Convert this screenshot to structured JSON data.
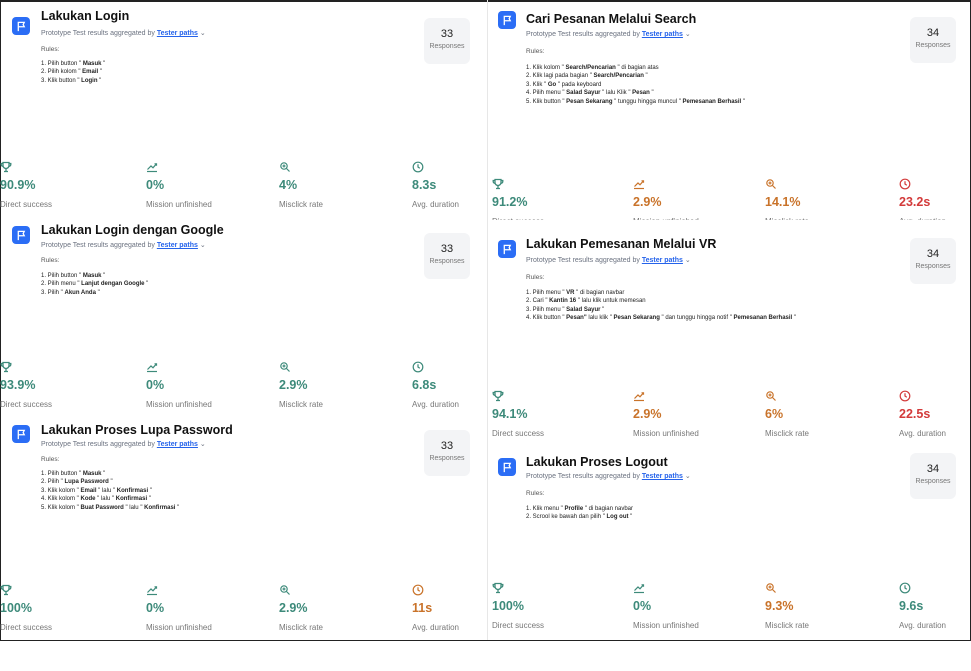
{
  "common": {
    "subtitle_prefix": "Prototype Test results aggregated by",
    "tester_paths": "Tester paths",
    "chevron": "⌄",
    "rules_label": "Rules:",
    "responses_label": "Responses",
    "labels": {
      "direct": "Direct success",
      "mission": "Mission unfinished",
      "misclick": "Misclick rate",
      "duration": "Avg. duration"
    }
  },
  "colors": {
    "accent": "#2b6df5",
    "green": "#3d8a7a",
    "orange": "#c9732a",
    "red": "#d33a3a"
  },
  "cards": [
    {
      "title": "Lakukan Login",
      "responses": "33",
      "rules": [
        [
          "1. Pilih button \" ",
          "Masuk",
          " \""
        ],
        [
          "2. Pilih kolom \" ",
          "Email",
          " \""
        ],
        [
          "3. Klik button \" ",
          "Login",
          " \""
        ]
      ],
      "direct": "90.9%",
      "mission": "0%",
      "misclick": "4%",
      "duration": "8.3s"
    },
    {
      "title": "Cari Pesanan Melalui Search",
      "responses": "34",
      "rules": [
        [
          "1. Klik kolom \" ",
          "Search/Pencarian",
          " \" di bagian atas"
        ],
        [
          "2. Klik lagi pada bagian \" ",
          "Search/Pencarian",
          " \""
        ],
        [
          "3. Klik \" ",
          "Go",
          " \" pada keyboard"
        ],
        [
          "4. Pilih menu \" ",
          "Salad Sayur",
          " \" lalu Klik \" ",
          "Pesan",
          " \""
        ],
        [
          "5. Klik button \" ",
          "Pesan Sekarang",
          " \" tunggu hingga muncul \" ",
          "Pemesanan Berhasil",
          " \""
        ]
      ],
      "direct": "91.2%",
      "mission": "2.9%",
      "misclick": "14.1%",
      "duration": "23.2s"
    },
    {
      "title": "Lakukan Login dengan Google",
      "responses": "33",
      "rules": [
        [
          "1. Pilih button \" ",
          "Masuk",
          " \""
        ],
        [
          "2. Pilih menu \" ",
          "Lanjut dengan Google",
          " \""
        ],
        [
          "3. Pilih \" ",
          "Akun Anda",
          " \""
        ]
      ],
      "direct": "93.9%",
      "mission": "0%",
      "misclick": "2.9%",
      "duration": "6.8s"
    },
    {
      "title": "Lakukan Pemesanan Melalui VR",
      "responses": "34",
      "rules": [
        [
          "1. Pilih menu \" ",
          "VR",
          " \" di bagian navbar"
        ],
        [
          "2. Cari \" ",
          "Kantin 16",
          " \" lalu klik untuk memesan"
        ],
        [
          "3. Pilih menu \" ",
          "Salad Sayur",
          " \""
        ],
        [
          "4. Klik button \" ",
          "Pesan\"",
          " lalu klik \" ",
          "Pesan Sekarang",
          " \" dan tunggu hingga notif \" ",
          "Pemesanan Berhasil",
          " \""
        ]
      ],
      "direct": "94.1%",
      "mission": "2.9%",
      "misclick": "6%",
      "duration": "22.5s"
    },
    {
      "title": "Lakukan Proses Lupa Password",
      "responses": "33",
      "rules": [
        [
          "1. Pilih button \" ",
          "Masuk",
          " \""
        ],
        [
          "2. Pilih \" ",
          "Lupa Password",
          " \""
        ],
        [
          "3. Klik kolom \" ",
          "Email",
          " \" lalu \" ",
          "Konfirmasi",
          " \""
        ],
        [
          "4. Klik kolom \" ",
          "Kode",
          " \" lalu \" ",
          "Konfirmasi",
          " \""
        ],
        [
          "5. Klik kolom \" ",
          "Buat Password",
          " \" lalu \" ",
          "Konfirmasi",
          " \""
        ]
      ],
      "direct": "100%",
      "mission": "0%",
      "misclick": "2.9%",
      "duration": "11s"
    },
    {
      "title": "Lakukan Proses Logout",
      "responses": "34",
      "rules": [
        [
          "1. Klik menu \" ",
          "Profile",
          " \" di bagian navbar"
        ],
        [
          "2. Scrool ke bawah dan pilih \" ",
          "Log out",
          " \""
        ]
      ],
      "direct": "100%",
      "mission": "0%",
      "misclick": "9.3%",
      "duration": "9.6s"
    }
  ]
}
